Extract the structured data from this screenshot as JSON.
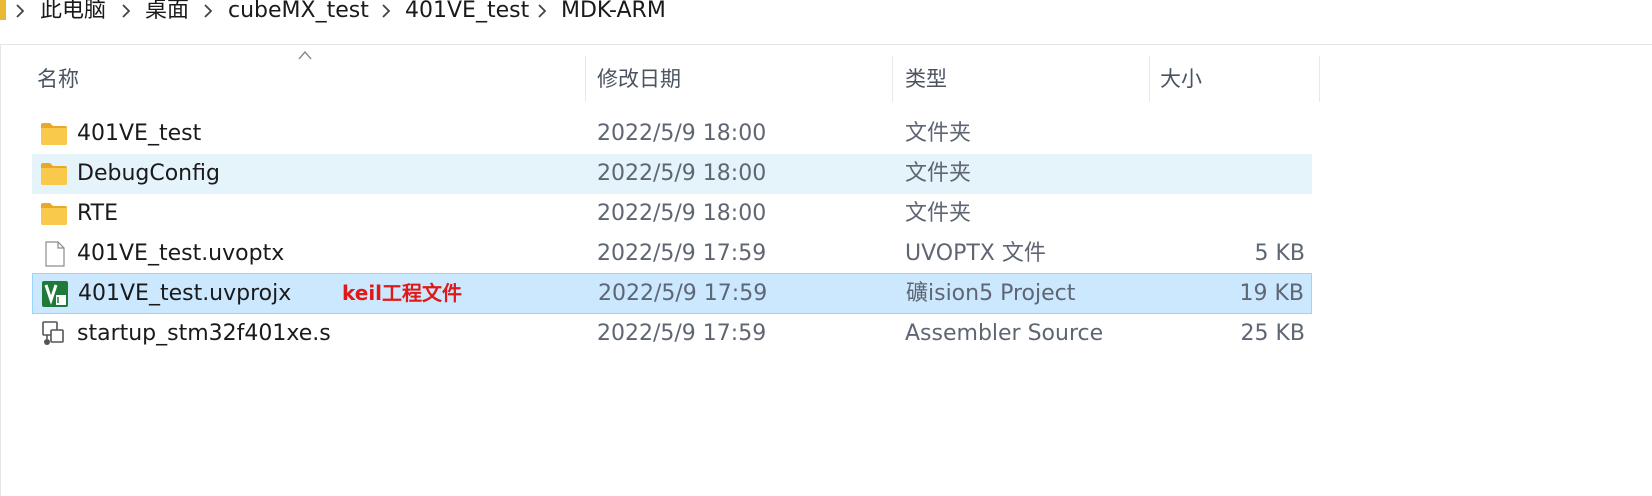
{
  "breadcrumb": {
    "items": [
      "此电脑",
      "桌面",
      "cubeMX_test",
      "401VE_test",
      "MDK-ARM"
    ]
  },
  "columns": {
    "name": "名称",
    "date": "修改日期",
    "type": "类型",
    "size": "大小"
  },
  "files": [
    {
      "name": "401VE_test",
      "date": "2022/5/9 18:00",
      "type": "文件夹",
      "size": "",
      "icon": "folder-icon",
      "state": "normal"
    },
    {
      "name": "DebugConfig",
      "date": "2022/5/9 18:00",
      "type": "文件夹",
      "size": "",
      "icon": "folder-icon",
      "state": "hover"
    },
    {
      "name": "RTE",
      "date": "2022/5/9 18:00",
      "type": "文件夹",
      "size": "",
      "icon": "folder-icon",
      "state": "normal"
    },
    {
      "name": "401VE_test.uvoptx",
      "date": "2022/5/9 17:59",
      "type": "UVOPTX 文件",
      "size": "5 KB",
      "icon": "file-icon",
      "state": "normal"
    },
    {
      "name": "401VE_test.uvprojx",
      "date": "2022/5/9 17:59",
      "type": "礦ision5 Project",
      "size": "19 KB",
      "icon": "keil-uvision-icon",
      "state": "selected"
    },
    {
      "name": "startup_stm32f401xe.s",
      "date": "2022/5/9 17:59",
      "type": "Assembler Source",
      "size": "25 KB",
      "icon": "assembler-source-icon",
      "state": "normal"
    }
  ],
  "annotation": {
    "text": "keil工程文件",
    "color": "#e01818"
  },
  "colors": {
    "hover_row": "#e5f3fb",
    "selected_row": "#cce8ff",
    "selected_border": "#99d1ff",
    "folder": "#f5c242"
  }
}
